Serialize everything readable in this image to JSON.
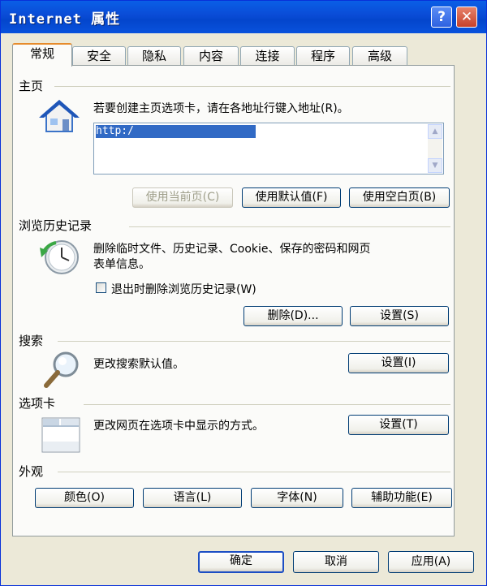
{
  "window": {
    "title": "Internet 属性",
    "help_label": "?",
    "close_label": "✕"
  },
  "tabs": [
    {
      "label": "常规",
      "active": true
    },
    {
      "label": "安全"
    },
    {
      "label": "隐私"
    },
    {
      "label": "内容"
    },
    {
      "label": "连接"
    },
    {
      "label": "程序"
    },
    {
      "label": "高级"
    }
  ],
  "home": {
    "section_title": "主页",
    "icon": "house-icon",
    "description": "若要创建主页选项卡，请在各地址行键入地址(R)。",
    "url_value": "http:/",
    "use_current_label": "使用当前页(C)",
    "use_default_label": "使用默认值(F)",
    "use_blank_label": "使用空白页(B)"
  },
  "history": {
    "section_title": "浏览历史记录",
    "icon": "clock-refresh-icon",
    "description_line1": "删除临时文件、历史记录、Cookie、保存的密码和网页",
    "description_line2": "表单信息。",
    "checkbox_label": "退出时删除浏览历史记录(W)",
    "checkbox_checked": false,
    "delete_label": "删除(D)...",
    "settings_label": "设置(S)"
  },
  "search": {
    "section_title": "搜索",
    "icon": "magnifier-icon",
    "description": "更改搜索默认值。",
    "settings_label": "设置(I)"
  },
  "tabs_section": {
    "section_title": "选项卡",
    "icon": "tab-window-icon",
    "description": "更改网页在选项卡中显示的方式。",
    "settings_label": "设置(T)"
  },
  "appearance": {
    "section_title": "外观",
    "colors_label": "颜色(O)",
    "languages_label": "语言(L)",
    "fonts_label": "字体(N)",
    "accessibility_label": "辅助功能(E)"
  },
  "footer": {
    "ok_label": "确定",
    "cancel_label": "取消",
    "apply_label": "应用(A)"
  },
  "colors": {
    "titlebar": "#0A5FE6",
    "dialog_bg": "#ECE9D8",
    "selection": "#316AC5",
    "close_button": "#C6412A"
  }
}
